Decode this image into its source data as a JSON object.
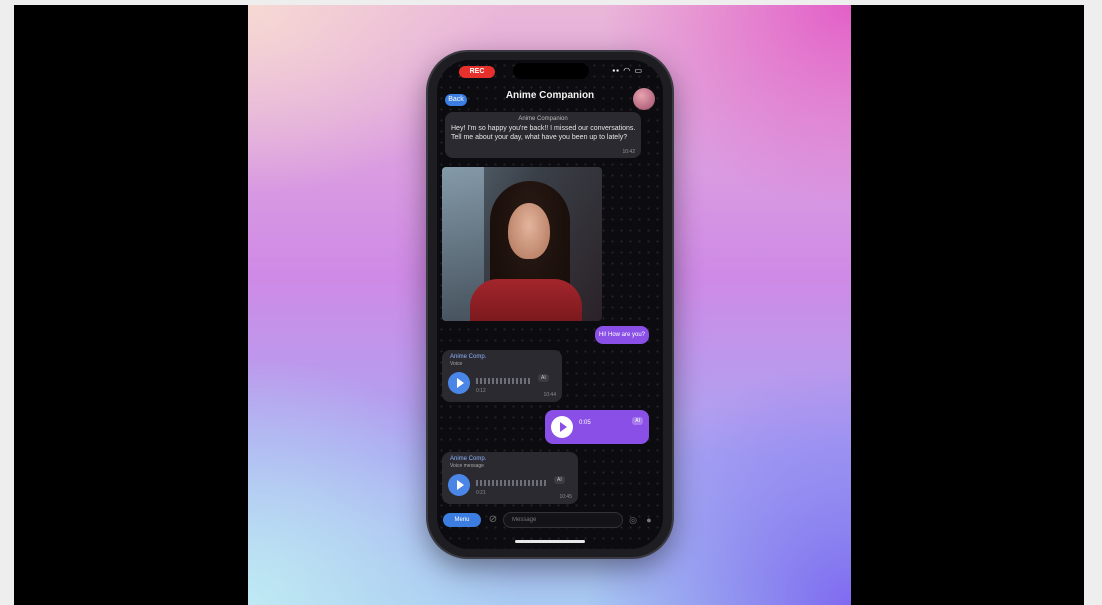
{
  "status_bar": {
    "recording": "REC",
    "icons": "▪▪ ◠ ▭"
  },
  "navbar": {
    "back_label": "Back",
    "title": "Anime Companion"
  },
  "pinned": {
    "sender": "Anime Companion",
    "text": "Hey! I'm so happy you're back!! I missed our conversations. Tell me about your day, what have you been up to lately?",
    "time": "10:42"
  },
  "messages": {
    "out_text": "Hi! How are you?",
    "voice1": {
      "sender": "Anime Comp.",
      "sub": "Voice",
      "duration": "0:12",
      "badge": "AI",
      "time": "10:44"
    },
    "voice_out": {
      "label": "0:05",
      "badge": "AI"
    },
    "voice2": {
      "sender": "Anime Comp.",
      "sub": "Voice message",
      "duration": "0:21",
      "badge": "AI",
      "time": "10:45"
    }
  },
  "input": {
    "menu_label": "Menu",
    "placeholder": "Message"
  }
}
